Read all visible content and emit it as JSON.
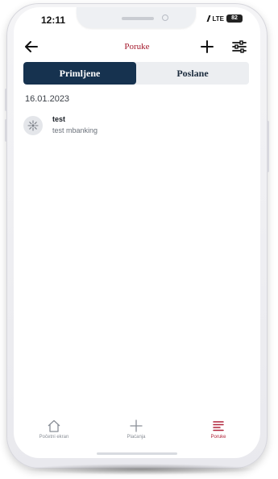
{
  "status_bar": {
    "time": "12:11",
    "network": "LTE",
    "battery": "82"
  },
  "header": {
    "title": "Poruke",
    "back_icon": "arrow-left-icon",
    "add_icon": "plus-icon",
    "filter_icon": "sliders-icon"
  },
  "tabs": [
    {
      "label": "Primljene",
      "active": true
    },
    {
      "label": "Poslane",
      "active": false
    }
  ],
  "messages_group": {
    "date": "16.01.2023",
    "items": [
      {
        "title": "test",
        "preview": "test mbanking",
        "icon": "sun-icon"
      }
    ]
  },
  "bottom_nav": [
    {
      "label": "Početni ekran",
      "icon": "home-icon",
      "active": false
    },
    {
      "label": "Plaćanja",
      "icon": "plus-icon",
      "active": false
    },
    {
      "label": "Poruke",
      "icon": "list-icon",
      "active": true
    }
  ],
  "colors": {
    "accent": "#a3182b",
    "tab_active_bg": "#16324f",
    "nav_active": "#b0243a"
  }
}
